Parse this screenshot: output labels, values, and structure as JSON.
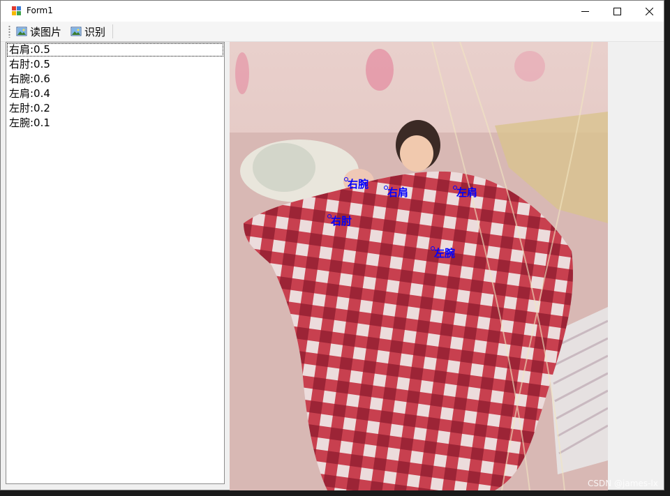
{
  "window": {
    "title": "Form1",
    "controls": [
      "minimize-icon",
      "maximize-icon",
      "close-icon"
    ]
  },
  "toolbar": {
    "read_image_label": "读图片",
    "recognize_label": "识别",
    "button_icon": "picture-icon"
  },
  "results": {
    "items": [
      {
        "label": "右肩:0.5"
      },
      {
        "label": "右肘:0.5"
      },
      {
        "label": "右腕:0.6"
      },
      {
        "label": "左肩:0.4"
      },
      {
        "label": "左肘:0.2"
      },
      {
        "label": "左腕:0.1"
      }
    ]
  },
  "image": {
    "keypoints": [
      {
        "label": "右腕"
      },
      {
        "label": "右肩"
      },
      {
        "label": "左肩"
      },
      {
        "label": "右肘"
      },
      {
        "label": "左腕"
      }
    ],
    "keypoint_color": "#0000ff"
  },
  "watermark": "CSDN @james-lx",
  "colors": {
    "window_bg": "#f0f0f0",
    "titlebar_bg": "#ffffff",
    "list_bg": "#ffffff"
  }
}
